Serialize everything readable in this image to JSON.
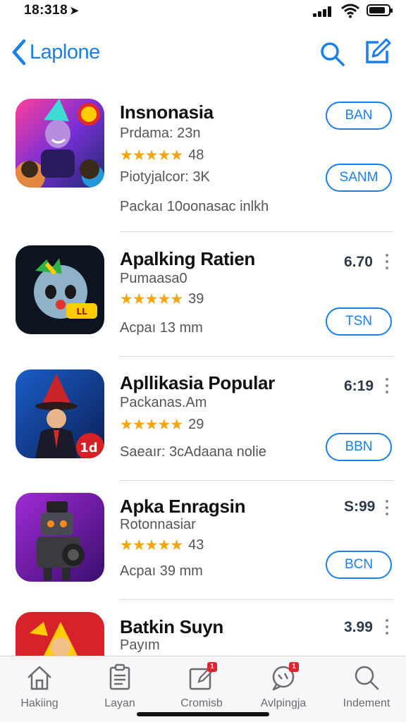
{
  "status": {
    "time": "18:318"
  },
  "nav": {
    "back_label": "Laplone",
    "back_icon": "chevron-left-icon",
    "search_icon": "search-icon",
    "compose_icon": "compose-icon",
    "accent": "#1a7fe8"
  },
  "apps": [
    {
      "name": "Insnonasia",
      "subtitle": "Prdama: 23n",
      "rating": "48",
      "stars_fill": 5,
      "info": "Piotyjalcor: 3K",
      "extra": "Packaı 10oonasac inlkh",
      "primary_button": "BAN",
      "secondary_button": "SANM"
    },
    {
      "name": "Apalking Ratien",
      "subtitle": "Pumaasa0",
      "rating": "39",
      "stars_fill": 5,
      "extra": "Acpaı 13 mm",
      "price": "6.70",
      "button": "TSN"
    },
    {
      "name": "Apllikasia Popular",
      "subtitle": "Packanas.Am",
      "rating": "29",
      "stars_fill": 4.5,
      "extra": "Saeaır: 3cAdaana nolie",
      "price": "6:19",
      "button": "BBN"
    },
    {
      "name": "Apka Enragsin",
      "subtitle": "Rotonnasiar",
      "rating": "43",
      "stars_fill": 4.5,
      "extra": "Acpaı 39 mm",
      "price": "S:99",
      "button": "BCN"
    },
    {
      "name": "Batkin Suyn",
      "subtitle": "Payım",
      "price": "3.99"
    }
  ],
  "tabs": [
    {
      "label": "Hakiing",
      "icon": "home-icon"
    },
    {
      "label": "Layan",
      "icon": "clipboard-icon"
    },
    {
      "label": "Cromisb",
      "icon": "edit-icon",
      "badge": "1"
    },
    {
      "label": "Avlpingja",
      "icon": "chat-icon",
      "badge": "1"
    },
    {
      "label": "Indement",
      "icon": "search-icon"
    }
  ],
  "colors": {
    "star": "#f2a50c",
    "badge": "#e0262c",
    "button": "#1a7fe8"
  }
}
